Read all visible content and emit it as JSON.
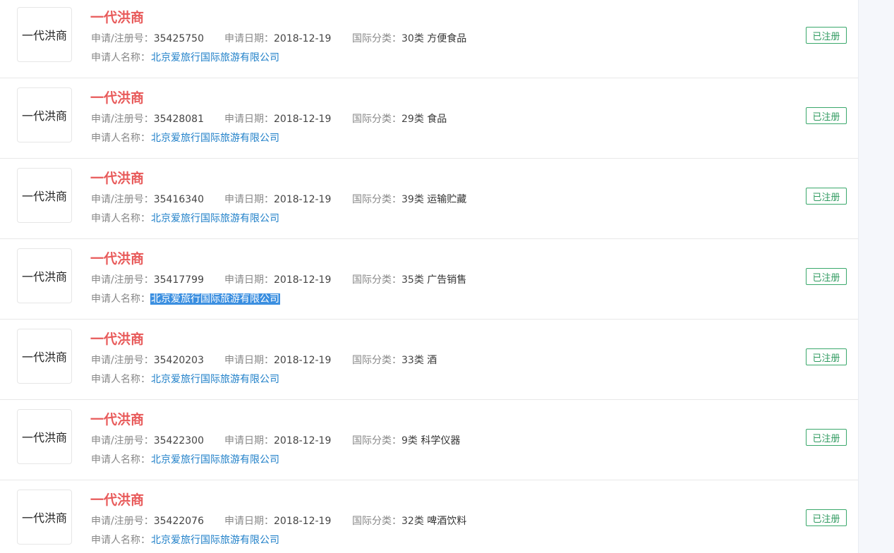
{
  "labels": {
    "reg_no": "申请/注册号：",
    "apply_date": "申请日期：",
    "intl_class": "国际分类：",
    "applicant": "申请人名称："
  },
  "items": [
    {
      "thumb_text": "一代洪商",
      "name": "一代洪商",
      "reg_no": "35425750",
      "apply_date": "2018-12-19",
      "class_no": "30类",
      "class_name": "方便食品",
      "applicant": "北京爱旅行国际旅游有限公司",
      "status": "已注册"
    },
    {
      "thumb_text": "一代洪商",
      "name": "一代洪商",
      "reg_no": "35428081",
      "apply_date": "2018-12-19",
      "class_no": "29类",
      "class_name": "食品",
      "applicant": "北京爱旅行国际旅游有限公司",
      "status": "已注册"
    },
    {
      "thumb_text": "一代洪商",
      "name": "一代洪商",
      "reg_no": "35416340",
      "apply_date": "2018-12-19",
      "class_no": "39类",
      "class_name": "运输贮藏",
      "applicant": "北京爱旅行国际旅游有限公司",
      "status": "已注册"
    },
    {
      "thumb_text": "一代洪商",
      "name": "一代洪商",
      "reg_no": "35417799",
      "apply_date": "2018-12-19",
      "class_no": "35类",
      "class_name": "广告销售",
      "applicant": "北京爱旅行国际旅游有限公司",
      "status": "已注册"
    },
    {
      "thumb_text": "一代洪商",
      "name": "一代洪商",
      "reg_no": "35420203",
      "apply_date": "2018-12-19",
      "class_no": "33类",
      "class_name": "酒",
      "applicant": "北京爱旅行国际旅游有限公司",
      "status": "已注册"
    },
    {
      "thumb_text": "一代洪商",
      "name": "一代洪商",
      "reg_no": "35422300",
      "apply_date": "2018-12-19",
      "class_no": "9类",
      "class_name": "科学仪器",
      "applicant": "北京爱旅行国际旅游有限公司",
      "status": "已注册"
    },
    {
      "thumb_text": "一代洪商",
      "name": "一代洪商",
      "reg_no": "35422076",
      "apply_date": "2018-12-19",
      "class_no": "32类",
      "class_name": "啤酒饮料",
      "applicant": "北京爱旅行国际旅游有限公司",
      "status": "已注册"
    }
  ],
  "colors": {
    "name_red": "#e85a5a",
    "link_blue": "#1e7fc8",
    "status_green": "#2f9a5f",
    "selection_blue": "#3b8fe0"
  }
}
